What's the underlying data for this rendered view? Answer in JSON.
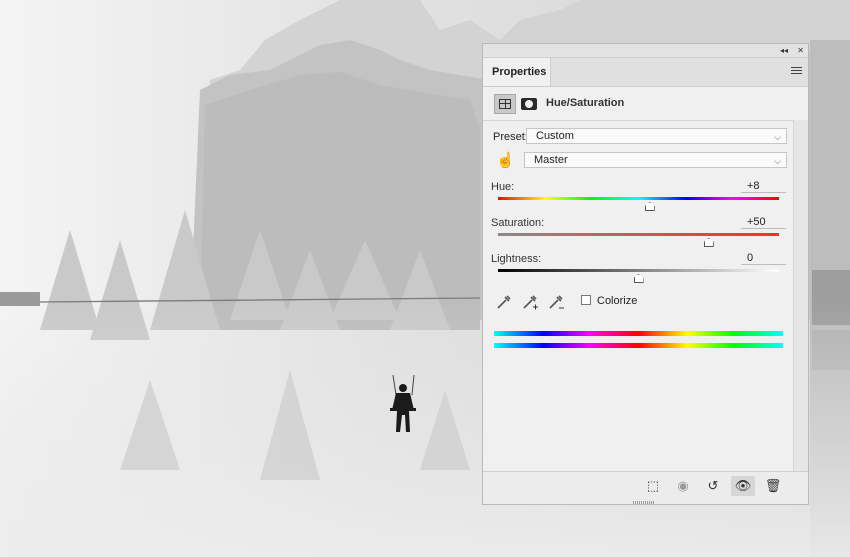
{
  "panel": {
    "tab_label": "Properties",
    "adjustment_title": "Hue/Saturation",
    "preset_label": "Preset:",
    "preset_value": "Custom",
    "channel_value": "Master",
    "colorize_label": "Colorize",
    "colorize_checked": false
  },
  "sliders": {
    "hue": {
      "label": "Hue:",
      "value": "+8",
      "position": 0.54
    },
    "saturation": {
      "label": "Saturation:",
      "value": "+50",
      "position": 0.75
    },
    "lightness": {
      "label": "Lightness:",
      "value": "0",
      "position": 0.5
    }
  },
  "icons": {
    "collapse": "double-chevron-left-icon",
    "close": "close-icon",
    "menu": "panel-menu-icon",
    "adjustment": "hue-saturation-adjustment-icon",
    "mask": "layer-mask-icon",
    "hand": "targeted-adjustment-hand-icon",
    "eyedroppers": [
      "eyedropper-icon",
      "eyedropper-add-icon",
      "eyedropper-subtract-icon"
    ],
    "footer": [
      "clip-to-layer-icon",
      "view-previous-state-icon",
      "reset-icon",
      "visibility-eye-icon",
      "trash-icon"
    ]
  },
  "colors": {
    "panel_bg": "#f0f0f0",
    "scene_fog": "#d9d9d9",
    "mountain_dark": "#a7a7a7"
  }
}
